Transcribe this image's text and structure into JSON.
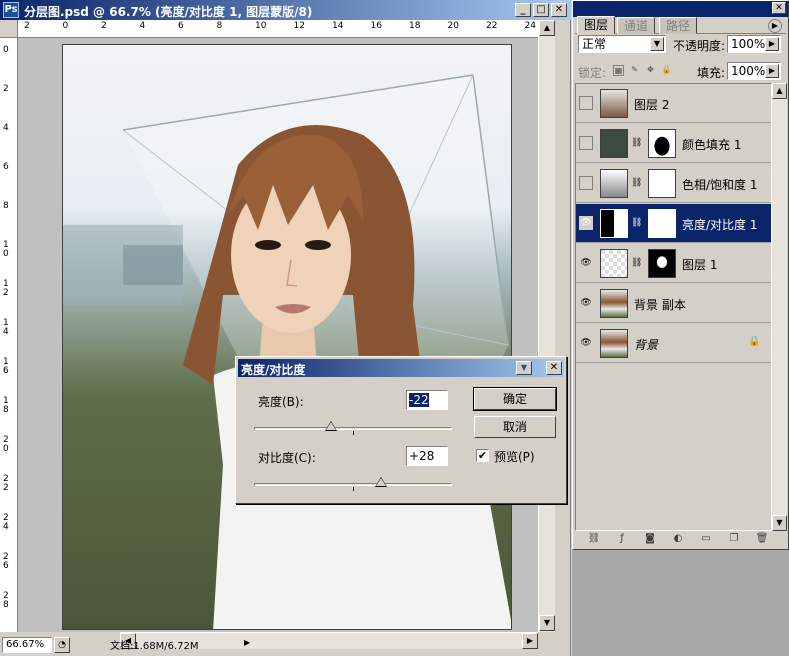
{
  "document": {
    "app_icon": "Ps",
    "title": "分层图.psd @ 66.7% (亮度/对比度 1, 图层蒙版/8)",
    "ruler_h_labels": [
      "2",
      "0",
      "2",
      "4",
      "6",
      "8",
      "10",
      "12",
      "14",
      "16",
      "18",
      "20",
      "22",
      "24"
    ],
    "ruler_v_labels": [
      "0",
      "2",
      "4",
      "6",
      "8",
      "1\n0",
      "1\n2",
      "1\n4",
      "1\n6",
      "1\n8",
      "2\n0",
      "2\n2",
      "2\n4",
      "2\n6",
      "2\n8"
    ],
    "zoom": "66.67%",
    "doc_size": "文档:1.68M/6.72M"
  },
  "dialog": {
    "title": "亮度/对比度",
    "brightness_label": "亮度(B):",
    "brightness_value": "-22",
    "brightness_level_fraction": 0.39,
    "contrast_label": "对比度(C):",
    "contrast_value": "+28",
    "contrast_level_fraction": 0.64,
    "ok_label": "确定",
    "cancel_label": "取消",
    "preview_label": "预览(P)",
    "preview_checked": "✔"
  },
  "layers_panel": {
    "tabs": [
      "图层",
      "通道",
      "路径"
    ],
    "blend_mode": "正常",
    "opacity_label": "不透明度:",
    "opacity_value": "100%",
    "lock_label": "锁定:",
    "fill_label": "填充:",
    "fill_value": "100%",
    "layers": [
      {
        "name": "图层 2",
        "visible": false
      },
      {
        "name": "颜色填充 1",
        "visible": false
      },
      {
        "name": "色相/饱和度 1",
        "visible": false
      },
      {
        "name": "亮度/对比度 1",
        "visible": true
      },
      {
        "name": "图层 1",
        "visible": true
      },
      {
        "name": "背景 副本",
        "visible": true
      },
      {
        "name": "背景",
        "visible": true
      }
    ]
  },
  "colors": {
    "title_blue": "#0a246a",
    "chrome_gray": "#d4d0c8"
  }
}
